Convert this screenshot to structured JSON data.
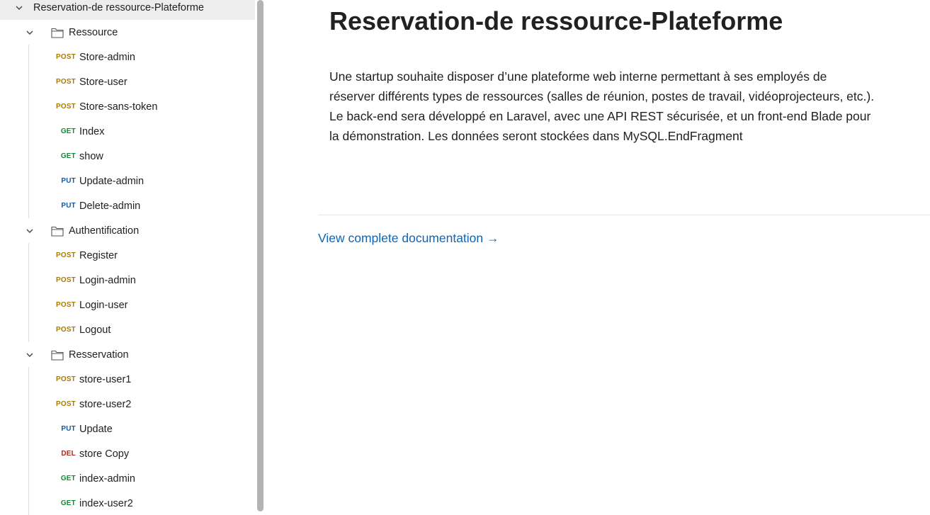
{
  "sidebar": {
    "collection": {
      "name": "Reservation-de ressource-Plateforme"
    },
    "folders": [
      {
        "name": "Ressource",
        "requests": [
          {
            "method": "POST",
            "name": "Store-admin"
          },
          {
            "method": "POST",
            "name": "Store-user"
          },
          {
            "method": "POST",
            "name": "Store-sans-token"
          },
          {
            "method": "GET",
            "name": "Index"
          },
          {
            "method": "GET",
            "name": "show"
          },
          {
            "method": "PUT",
            "name": "Update-admin"
          },
          {
            "method": "PUT",
            "name": "Delete-admin"
          }
        ]
      },
      {
        "name": "Authentification",
        "requests": [
          {
            "method": "POST",
            "name": "Register"
          },
          {
            "method": "POST",
            "name": "Login-admin"
          },
          {
            "method": "POST",
            "name": "Login-user"
          },
          {
            "method": "POST",
            "name": "Logout"
          }
        ]
      },
      {
        "name": "Resservation",
        "requests": [
          {
            "method": "POST",
            "name": "store-user1"
          },
          {
            "method": "POST",
            "name": "store-user2"
          },
          {
            "method": "PUT",
            "name": "Update"
          },
          {
            "method": "DEL",
            "name": "store Copy"
          },
          {
            "method": "GET",
            "name": "index-admin"
          },
          {
            "method": "GET",
            "name": "index-user2"
          }
        ]
      }
    ]
  },
  "main": {
    "title": "Reservation-de ressource-Plateforme",
    "description": "Une startup souhaite disposer d’une plateforme web interne permettant à ses employés de réserver différents types de ressources (salles de réunion, postes de travail, vidéoprojecteurs, etc.). Le back-end sera développé en Laravel, avec une API REST sécurisée, et un front-end Blade pour la démonstration. Les données seront stockées dans MySQL.EndFragment",
    "link_label": "View complete documentation →"
  },
  "colors": {
    "post": "#a77a00",
    "get": "#0d8a3a",
    "put": "#0f5aa8",
    "del": "#b02a1e",
    "link": "#0b66b8"
  }
}
